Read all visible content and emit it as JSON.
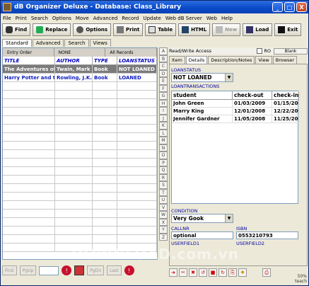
{
  "window": {
    "title": "dB Organizer Deluxe - Database: Class_Library",
    "controls": [
      "_",
      "□",
      "X"
    ]
  },
  "menu": [
    "File",
    "Print",
    "Search",
    "Options",
    "Move",
    "Advanced",
    "Record",
    "Update",
    "Web dB Server",
    "Web",
    "Help"
  ],
  "toolbar": [
    {
      "label": "Find",
      "icon": "binoculars-icon",
      "enabled": true
    },
    {
      "label": "Replace",
      "icon": "replace-icon",
      "enabled": true
    },
    {
      "label": "Options",
      "icon": "gear-icon",
      "enabled": true
    },
    {
      "label": "Print",
      "icon": "printer-icon",
      "enabled": true
    },
    {
      "label": "Table",
      "icon": "table-icon",
      "enabled": true
    },
    {
      "label": "HTML",
      "icon": "html-icon",
      "enabled": true
    },
    {
      "label": "New",
      "icon": "new-icon",
      "enabled": false
    },
    {
      "label": "Load",
      "icon": "load-icon",
      "enabled": true
    },
    {
      "label": "Exit",
      "icon": "exit-icon",
      "enabled": true
    }
  ],
  "view_tabs": [
    "Standard",
    "Advanced",
    "Search",
    "Views"
  ],
  "sortbar": [
    "Entry Order",
    "NONE",
    "All Records"
  ],
  "grid": {
    "columns": [
      "TITLE",
      "AUTHOR",
      "TYPE",
      "LOANSTATUS"
    ],
    "rows": [
      [
        "The Adventures of I",
        "Twain, Mark",
        "Book",
        "NOT LOANED"
      ],
      [
        "Harry Potter and the",
        "Rowling, J.K.",
        "Book",
        "LOANED"
      ]
    ]
  },
  "nav": {
    "first": "First",
    "pgup": "PgUp",
    "pgdn": "PgDn",
    "last": "Last"
  },
  "letters": [
    "A",
    "B",
    "C",
    "D",
    "E",
    "F",
    "G",
    "H",
    "I",
    "J",
    "K",
    "L",
    "M",
    "N",
    "O",
    "P",
    "Q",
    "R",
    "S",
    "T",
    "U",
    "V",
    "W",
    "X",
    "Y",
    "Z"
  ],
  "right": {
    "header": "Read/Write Access",
    "ro_label": "RO",
    "blank_label": "Blank",
    "tabs": [
      "Item",
      "Details",
      "Description/Notes",
      "View",
      "Browser"
    ],
    "active_tab": "Details",
    "loanstatus_label": "LOANSTATUS",
    "loanstatus_value": "NOT LOANED",
    "transactions_label": "LOANTRANSACTIONS",
    "tx_columns": [
      "student",
      "check-out",
      "check-in"
    ],
    "tx_rows": [
      [
        "John Green",
        "01/03/2009",
        "01/15/2009"
      ],
      [
        "Marry King",
        "12/01/2008",
        "12/22/2008"
      ],
      [
        "Jennifer Gardner",
        "11/05/2008",
        "11/25/2008"
      ]
    ],
    "condition_label": "CONDITION",
    "condition_value": "Very Gook",
    "callnr_label": "CALLNR",
    "callnr_value": "optional",
    "isbn_label": "ISBN",
    "isbn_value": "0553210793",
    "userfield1_label": "USERFIELD1",
    "userfield2_label": "USERFIELD2"
  },
  "status": {
    "zoom": "50%",
    "user": "teach"
  },
  "watermark": "DOWNLOAD.com.vn"
}
